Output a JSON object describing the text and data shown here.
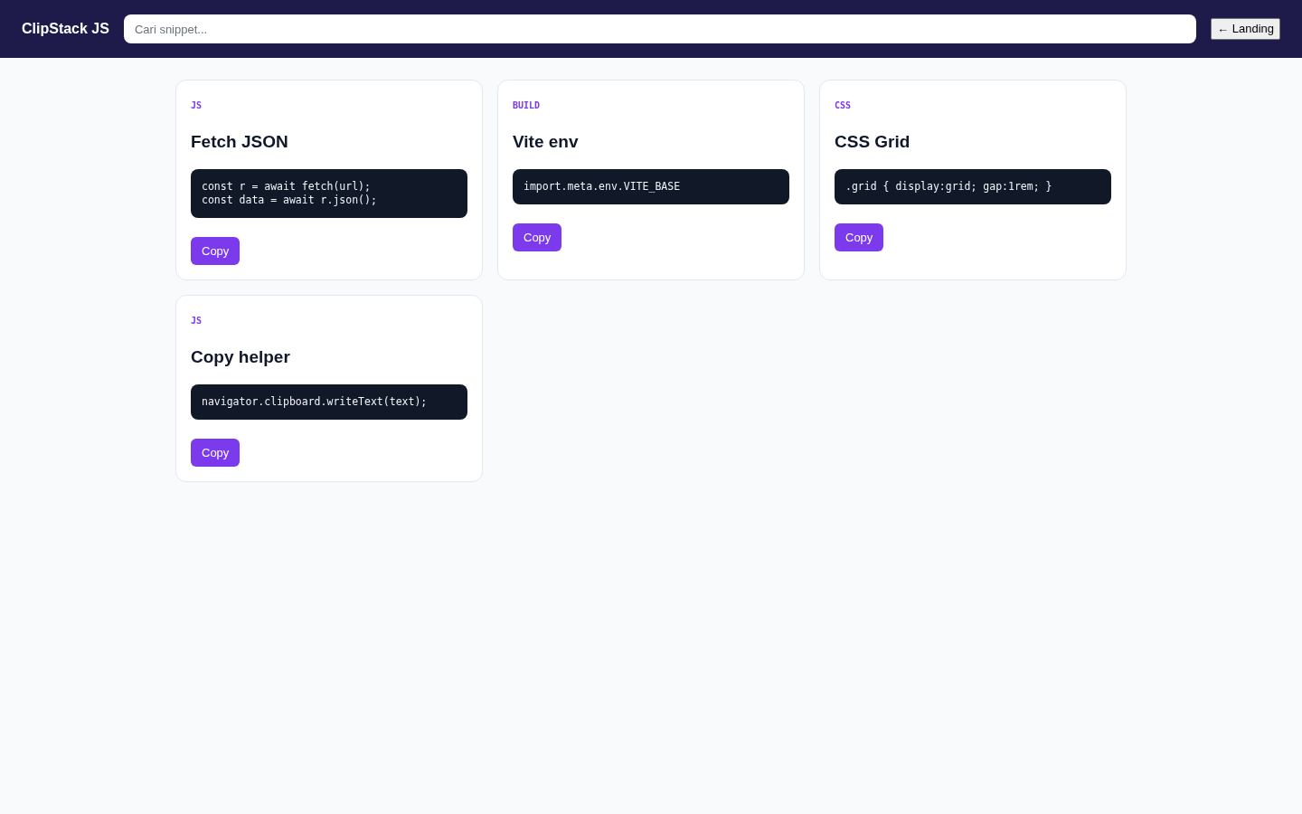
{
  "header": {
    "brand": "ClipStack JS",
    "search": {
      "placeholder": "Cari snippet..."
    },
    "back_button": "← Landing"
  },
  "snippets": [
    {
      "tag": "JS",
      "title": "Fetch JSON",
      "code": "const r = await fetch(url);\nconst data = await r.json();",
      "button": "Copy"
    },
    {
      "tag": "BUILD",
      "title": "Vite env",
      "code": "import.meta.env.VITE_BASE",
      "button": "Copy"
    },
    {
      "tag": "CSS",
      "title": "CSS Grid",
      "code": ".grid { display:grid; gap:1rem; }",
      "button": "Copy"
    },
    {
      "tag": "JS",
      "title": "Copy helper",
      "code": "navigator.clipboard.writeText(text);",
      "button": "Copy"
    }
  ]
}
